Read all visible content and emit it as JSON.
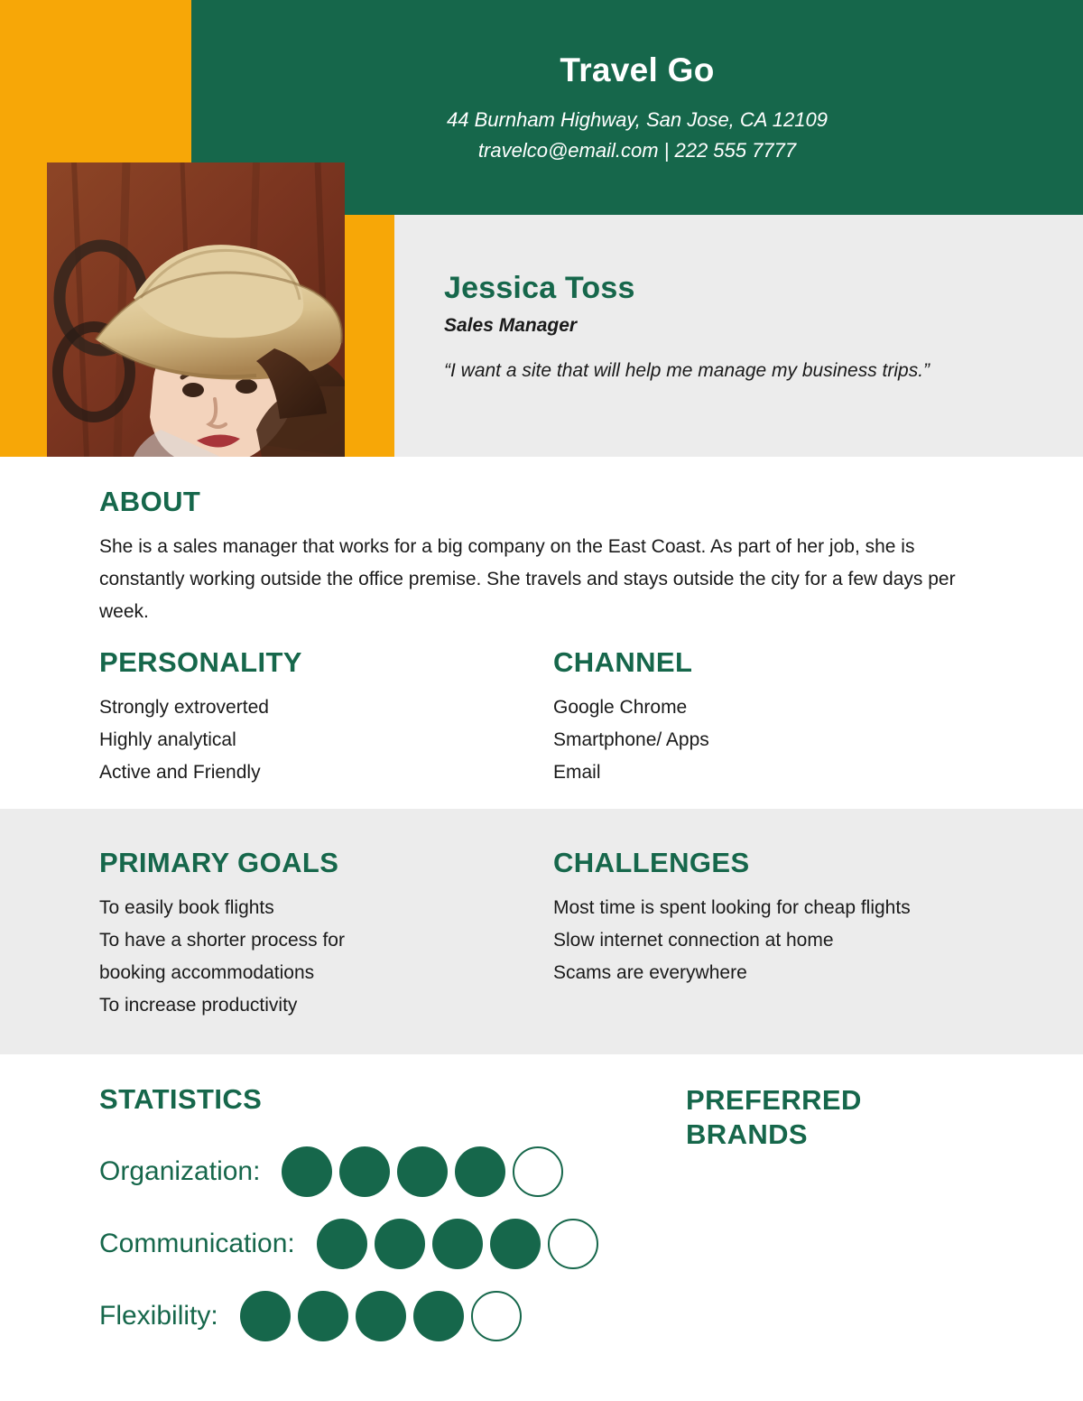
{
  "colors": {
    "green": "#16674b",
    "orange": "#f7a707",
    "light_gray": "#ececec",
    "white": "#ffffff"
  },
  "header": {
    "company_name": "Travel Go",
    "address": "44 Burnham Highway, San Jose, CA 12109",
    "contact": "travelco@email.com | 222 555 7777"
  },
  "profile": {
    "photo_alt": "portrait-photo",
    "name": "Jessica Toss",
    "role": "Sales Manager",
    "quote": "“I want a site that will help me manage my business trips.”"
  },
  "about": {
    "heading": "ABOUT",
    "text": "She is a sales manager that works for a big company on the East Coast. As part of her job, she is constantly working outside the office premise. She travels and stays outside the city for a few days per week."
  },
  "personality": {
    "heading": "PERSONALITY",
    "items": [
      "Strongly extroverted",
      "Highly analytical",
      "Active and Friendly"
    ]
  },
  "channel": {
    "heading": "CHANNEL",
    "items": [
      "Google Chrome",
      "Smartphone/ Apps",
      "Email"
    ]
  },
  "primary_goals": {
    "heading": "PRIMARY GOALS",
    "items": [
      "To easily book flights",
      "To have a shorter process for",
      "booking accommodations",
      "To increase productivity"
    ]
  },
  "challenges": {
    "heading": "CHALLENGES",
    "items": [
      "Most time is spent looking for cheap flights",
      "Slow internet connection at home",
      "Scams are everywhere"
    ]
  },
  "statistics": {
    "heading": "STATISTICS",
    "max_rating": 5,
    "rows": [
      {
        "label": "Organization:",
        "rating": 4
      },
      {
        "label": "Communication:",
        "rating": 4
      },
      {
        "label": "Flexibility:",
        "rating": 4
      }
    ]
  },
  "preferred_brands": {
    "heading": "PREFERRED BRANDS",
    "items": []
  }
}
